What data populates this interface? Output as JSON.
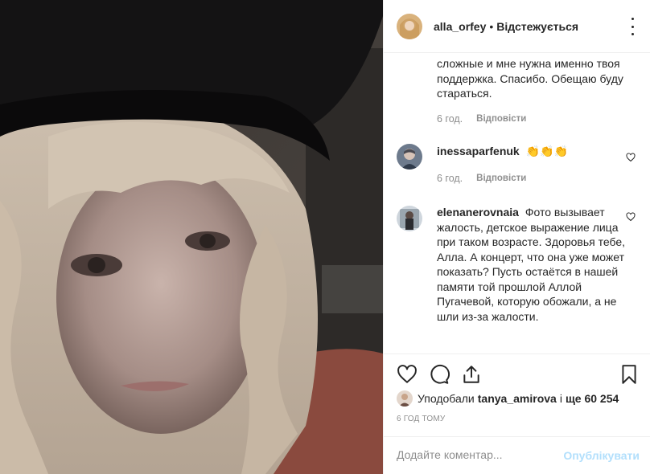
{
  "header": {
    "username": "alla_orfey",
    "separator": "•",
    "follow_status": "Відстежується"
  },
  "comments": {
    "continued_text": "сложные и мне нужна именно твоя поддержка. Спасибо. Обещаю буду стараться.",
    "continued_time": "6 год.",
    "reply_label": "Відповісти",
    "items": [
      {
        "username": "inessaparfenuk",
        "text": "👏👏👏",
        "time": "6 год.",
        "reply": "Відповісти"
      },
      {
        "username": "elenanerovnaia",
        "text": "Фото вызывает жалость, детское выражение лица при таком возрасте. Здоровья тебе, Алла. А концерт, что она уже может показать? Пусть остаётся в нашей памяти той прошлой Аллой Пугачевой, которую обожали, а не шли из-за жалости."
      }
    ]
  },
  "icons": {
    "like": "heart-icon",
    "comment": "comment-bubble-icon",
    "share": "share-icon",
    "save": "bookmark-icon",
    "more": "more-options-icon"
  },
  "likes": {
    "prefix": "Уподобали",
    "user": "tanya_amirova",
    "middle": "і",
    "count": "ще 60 254"
  },
  "post_time": "6 ГОД ТОМУ",
  "add_comment": {
    "placeholder": "Додайте коментар...",
    "publish_label": "Опублікувати"
  },
  "colors": {
    "text": "#262626",
    "muted": "#8e8e8e",
    "border": "#efefef",
    "publish_disabled": "#b2dffc"
  }
}
